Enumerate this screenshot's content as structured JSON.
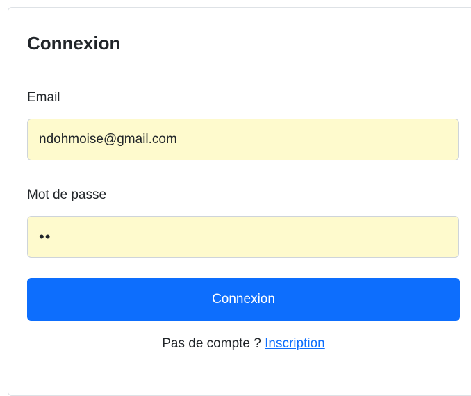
{
  "login": {
    "title": "Connexion",
    "email_label": "Email",
    "email_value": "ndohmoise@gmail.com",
    "password_label": "Mot de passe",
    "password_value": "ab",
    "submit_label": "Connexion",
    "footer_text": "Pas de compte ?",
    "signup_link": "Inscription"
  },
  "colors": {
    "primary": "#0d6efd",
    "autofill_bg": "#fefacd",
    "text": "#212529",
    "border": "#ced4da"
  }
}
